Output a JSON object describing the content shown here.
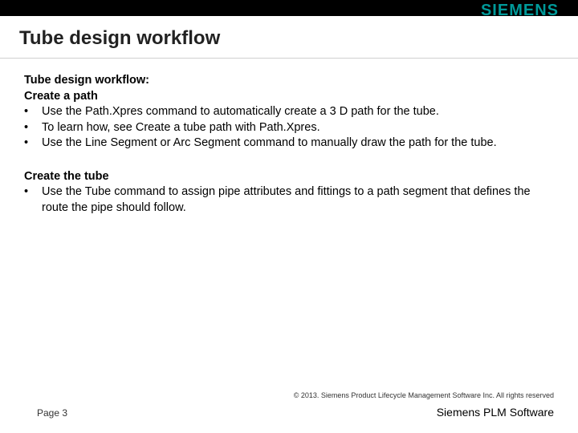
{
  "header": {
    "title": "Tube design workflow",
    "logo": "SIEMENS"
  },
  "section1": {
    "title": "Tube design workflow:",
    "subtitle": "Create a path",
    "bullets": [
      "Use the Path.Xpres command to automatically create a 3 D path for the tube.",
      "To learn how, see Create a tube path with Path.Xpres.",
      "Use the Line Segment or Arc Segment command to manually draw the path for the tube."
    ]
  },
  "section2": {
    "subtitle": "Create the tube",
    "bullets": [
      "Use the Tube command to assign pipe attributes and fittings to a path segment that defines the route the pipe should follow."
    ]
  },
  "footer": {
    "copyright": "© 2013. Siemens Product Lifecycle Management Software Inc. All rights reserved",
    "page": "Page 3",
    "brand": "Siemens PLM Software"
  }
}
